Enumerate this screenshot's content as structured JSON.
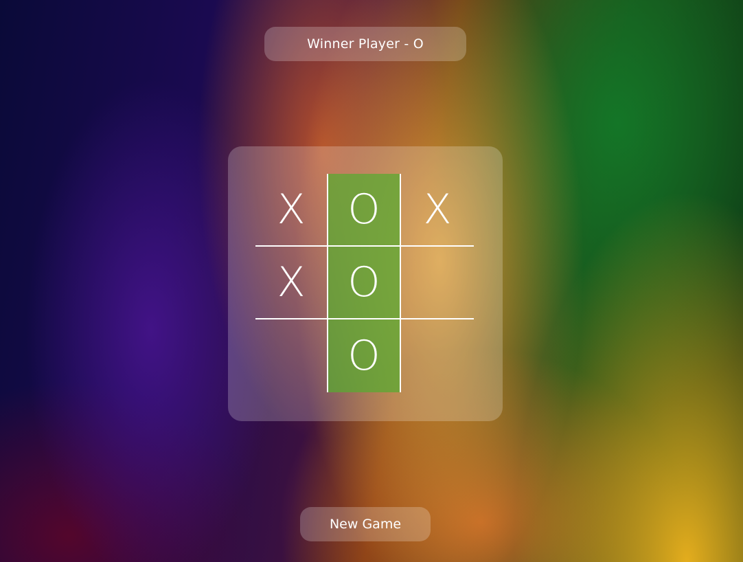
{
  "status": {
    "text": "Winner Player - O"
  },
  "board": {
    "cells": [
      "X",
      "O",
      "X",
      "X",
      "O",
      "",
      "",
      "O",
      ""
    ],
    "winning_cells": [
      1,
      4,
      7
    ],
    "winning_color": "#5aaa32"
  },
  "controls": {
    "new_game_label": "New Game"
  }
}
